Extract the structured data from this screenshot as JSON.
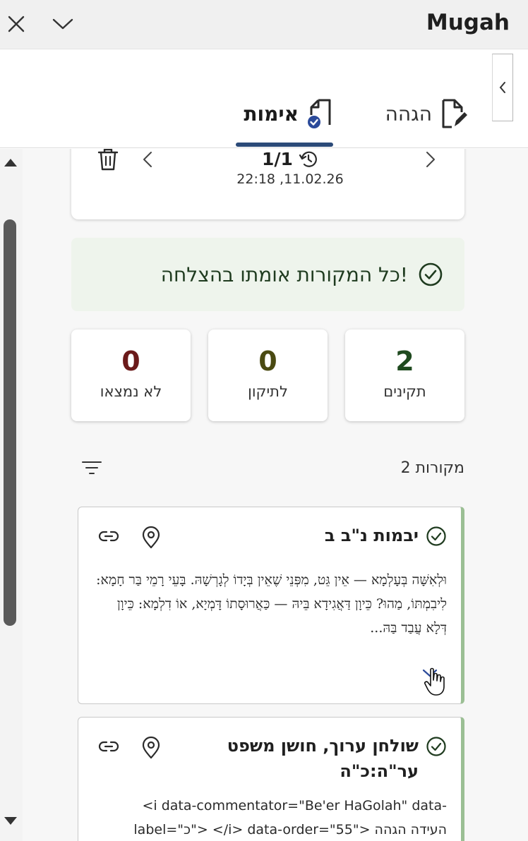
{
  "window": {
    "app_name": "Mugah"
  },
  "tabs": [
    {
      "label": "הגהה",
      "icon": "document-edit-icon"
    },
    {
      "label": "אימות",
      "icon": "document-check-icon"
    }
  ],
  "version": {
    "count": "1/1",
    "date": "22:18 ,11.02.26"
  },
  "success_banner": {
    "text": "כל המקורות אומתו בהצלחה!"
  },
  "stats": {
    "valid": {
      "value": "2",
      "label": "תקינים",
      "color": "#1f4a1f"
    },
    "to_fix": {
      "value": "0",
      "label": "לתיקון",
      "color": "#4a4a12"
    },
    "not_found": {
      "value": "0",
      "label": "לא נמצאו",
      "color": "#6b1a1a"
    }
  },
  "sources": {
    "count_label": "2 מקורות",
    "items": [
      {
        "title": "יבמות נ\"ב ב",
        "text": "וּלְאִשָּׁה בְּעָלְמָא — אֵין גֵּט, מִפְּנֵי שֶׁאֵין בְּיָדוֹ לְגָרְשָׁהּ. בָּעֵי רָמֵי בַּר חָמָא: לִיבִמְתּוֹ, מַהוּ? כֵּיוָן דַּאֲגִידָא בֵּיהּ — כַּאֲרוּסָתוֹ דָּמְיָא, אוֹ דִלְמָא: כֵּיוָן דְּלָא עֲבַד בַּהּ..."
      },
      {
        "title": "שולחן ערוך, חושן משפט ער\"ה:כ\"ה",
        "text": "<i data-commentator=\"Be'er HaGolah\" data-label=\"כ\"> </i> data-order=\"55\"> העידה הגהה"
      }
    ]
  },
  "colors": {
    "accent": "#2b4a78",
    "success_bg": "#eef4ec",
    "card_border_valid": "#9bbf94"
  }
}
